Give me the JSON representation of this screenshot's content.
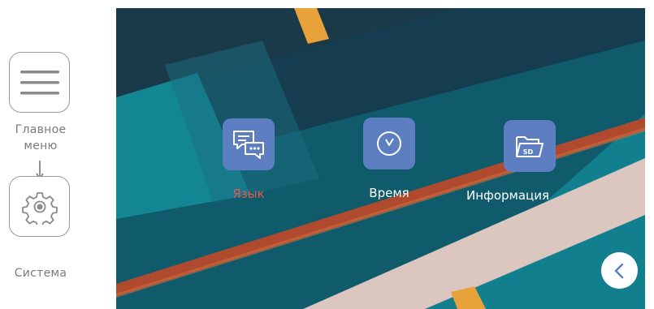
{
  "flow": {
    "main_menu_label_line1": "Главное",
    "main_menu_label_line2": "меню",
    "system_label": "Система",
    "main_menu_icon": "hamburger-menu-icon",
    "system_icon": "gear-icon",
    "arrow_icon": "arrow-down-icon"
  },
  "screen": {
    "items": [
      {
        "label": "Язык",
        "icon": "chat-bubbles-icon",
        "selected": true
      },
      {
        "label": "Время",
        "icon": "clock-icon",
        "selected": false
      },
      {
        "label": "Информация",
        "icon": "sd-folder-icon",
        "selected": false
      }
    ],
    "sd_badge": "SD",
    "back_icon": "chevron-left-icon"
  },
  "colors": {
    "selected_label": "#e05a4f",
    "tile": "#5d7fc2",
    "accent_stripe": "#e8a23a",
    "teal": "#138291",
    "dark": "#16394a"
  }
}
